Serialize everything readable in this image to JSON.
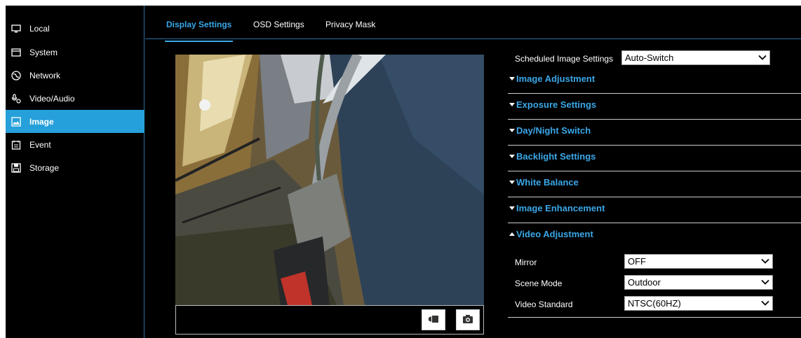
{
  "sidebar": {
    "items": [
      {
        "label": "Local",
        "icon": "monitor-icon"
      },
      {
        "label": "System",
        "icon": "system-icon"
      },
      {
        "label": "Network",
        "icon": "globe-icon"
      },
      {
        "label": "Video/Audio",
        "icon": "microphone-icon"
      },
      {
        "label": "Image",
        "icon": "image-icon",
        "active": true
      },
      {
        "label": "Event",
        "icon": "calendar-icon"
      },
      {
        "label": "Storage",
        "icon": "floppy-icon"
      }
    ]
  },
  "tabs": [
    {
      "label": "Display Settings",
      "active": true
    },
    {
      "label": "OSD Settings"
    },
    {
      "label": "Privacy Mask"
    }
  ],
  "scheduled": {
    "label": "Scheduled Image Settings",
    "value": "Auto-Switch"
  },
  "sections": [
    {
      "title": "Image Adjustment",
      "expanded": false
    },
    {
      "title": "Exposure Settings",
      "expanded": false
    },
    {
      "title": "Day/Night Switch",
      "expanded": false
    },
    {
      "title": "Backlight Settings",
      "expanded": false
    },
    {
      "title": "White Balance",
      "expanded": false
    },
    {
      "title": "Image Enhancement",
      "expanded": false
    },
    {
      "title": "Video Adjustment",
      "expanded": true
    }
  ],
  "video_adjustment": {
    "mirror": {
      "label": "Mirror",
      "value": "OFF"
    },
    "scene_mode": {
      "label": "Scene Mode",
      "value": "Outdoor"
    },
    "video_standard": {
      "label": "Video Standard",
      "value": "NTSC(60HZ)"
    }
  },
  "toolbar": {
    "record_icon": "record-icon",
    "snapshot_icon": "camera-icon"
  },
  "colors": {
    "accent": "#26a0da",
    "link": "#3aa7e8",
    "background": "#000000"
  }
}
